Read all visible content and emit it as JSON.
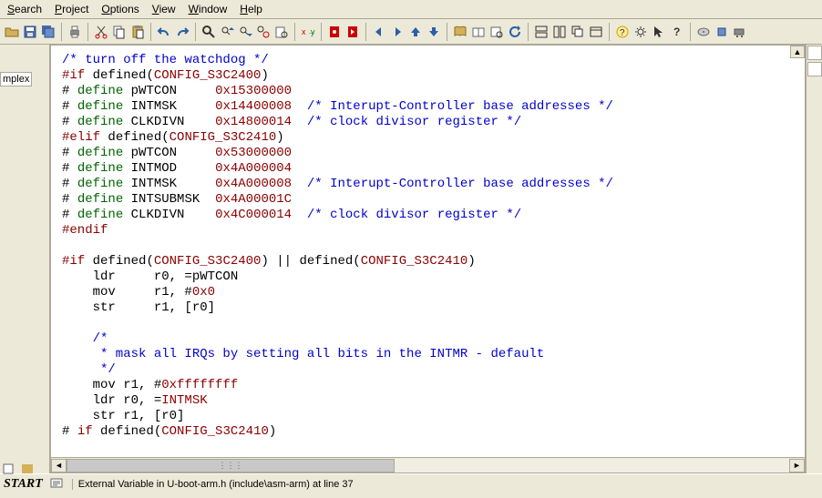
{
  "menu": {
    "search": "Search",
    "project": "Project",
    "options": "Options",
    "view": "View",
    "window": "Window",
    "help": "Help"
  },
  "left_tab": "mplex",
  "code": {
    "l1": "/* turn off the watchdog */",
    "l2a": "#if",
    "l2b": " defined",
    "l2c": "(",
    "l2d": "CONFIG_S3C2400",
    "l2e": ")",
    "l3a": "# ",
    "l3b": "define",
    "l3c": " pWTCON     ",
    "l3d": "0x15300000",
    "l4a": "# ",
    "l4b": "define",
    "l4c": " INTMSK     ",
    "l4d": "0x14400008",
    "l4e": "  /* Interupt-Controller base addresses */",
    "l5a": "# ",
    "l5b": "define",
    "l5c": " CLKDIVN    ",
    "l5d": "0x14800014",
    "l5e": "  /* clock divisor register */",
    "l6a": "#elif",
    "l6b": " defined",
    "l6c": "(",
    "l6d": "CONFIG_S3C2410",
    "l6e": ")",
    "l7a": "# ",
    "l7b": "define",
    "l7c": " pWTCON     ",
    "l7d": "0x53000000",
    "l8a": "# ",
    "l8b": "define",
    "l8c": " INTMOD     ",
    "l8d": "0x4A000004",
    "l9a": "# ",
    "l9b": "define",
    "l9c": " INTMSK     ",
    "l9d": "0x4A000008",
    "l9e": "  /* Interupt-Controller base addresses */",
    "l10a": "# ",
    "l10b": "define",
    "l10c": " INTSUBMSK  ",
    "l10d": "0x4A00001C",
    "l11a": "# ",
    "l11b": "define",
    "l11c": " CLKDIVN    ",
    "l11d": "0x4C000014",
    "l11e": "  /* clock divisor register */",
    "l12": "#endif",
    "l14a": "#if",
    "l14b": " defined",
    "l14c": "(",
    "l14d": "CONFIG_S3C2400",
    "l14e": ") || defined(",
    "l14f": "CONFIG_S3C2410",
    "l14g": ")",
    "l15": "    ldr     r0, =pWTCON",
    "l16a": "    mov     r1, #",
    "l16b": "0x0",
    "l17": "    str     r1, [r0]",
    "l19": "    /*",
    "l20": "     * mask all IRQs by setting all bits in the INTMR - default",
    "l21": "     */",
    "l22a": "    mov r1, #",
    "l22b": "0xffffffff",
    "l23a": "    ldr r0, =",
    "l23b": "INTMSK",
    "l24": "    str r1, [r0]",
    "l25a": "# ",
    "l25b": "if",
    "l25c": " defined(",
    "l25d": "CONFIG_S3C2410",
    "l25e": ")"
  },
  "status": {
    "start": "START",
    "msg": "External Variable in U-boot-arm.h (include\\asm-arm) at line 37"
  }
}
